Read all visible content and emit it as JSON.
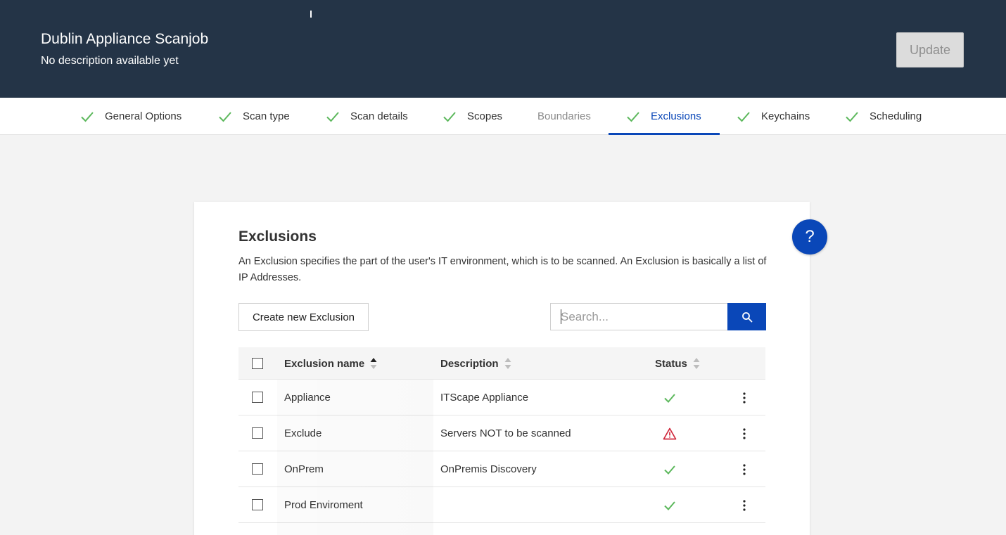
{
  "header": {
    "title": "Dublin Appliance Scanjob",
    "subtitle": "No description available yet",
    "update_label": "Update"
  },
  "tabs": [
    {
      "label": "General Options",
      "completed": true,
      "active": false,
      "enabled": true
    },
    {
      "label": "Scan type",
      "completed": true,
      "active": false,
      "enabled": true
    },
    {
      "label": "Scan details",
      "completed": true,
      "active": false,
      "enabled": true
    },
    {
      "label": "Scopes",
      "completed": true,
      "active": false,
      "enabled": true
    },
    {
      "label": "Boundaries",
      "completed": false,
      "active": false,
      "enabled": false
    },
    {
      "label": "Exclusions",
      "completed": true,
      "active": true,
      "enabled": true
    },
    {
      "label": "Keychains",
      "completed": true,
      "active": false,
      "enabled": true
    },
    {
      "label": "Scheduling",
      "completed": true,
      "active": false,
      "enabled": true
    }
  ],
  "main": {
    "title": "Exclusions",
    "description": "An Exclusion specifies the part of the user's IT environment, which is to be scanned. An Exclusion is basically a list of IP Addresses.",
    "create_label": "Create new Exclusion",
    "search": {
      "placeholder": "Search...",
      "value": "",
      "icon": "search-icon"
    },
    "table": {
      "columns": [
        "Exclusion name",
        "Description",
        "Status"
      ],
      "sorted_column": "Exclusion name",
      "sort_direction": "ascending",
      "rows": [
        {
          "name": "Appliance",
          "description": "ITScape Appliance",
          "status": "ok"
        },
        {
          "name": "Exclude",
          "description": "Servers NOT to be scanned",
          "status": "warning"
        },
        {
          "name": "OnPrem",
          "description": "OnPremis Discovery",
          "status": "ok"
        },
        {
          "name": "Prod Enviroment",
          "description": "",
          "status": "ok"
        }
      ]
    }
  },
  "help": {
    "label": "?"
  },
  "colors": {
    "header_bg": "#243447",
    "accent": "#0a47b8",
    "check_green": "#5cb85c",
    "warning_red": "#d0283c"
  }
}
